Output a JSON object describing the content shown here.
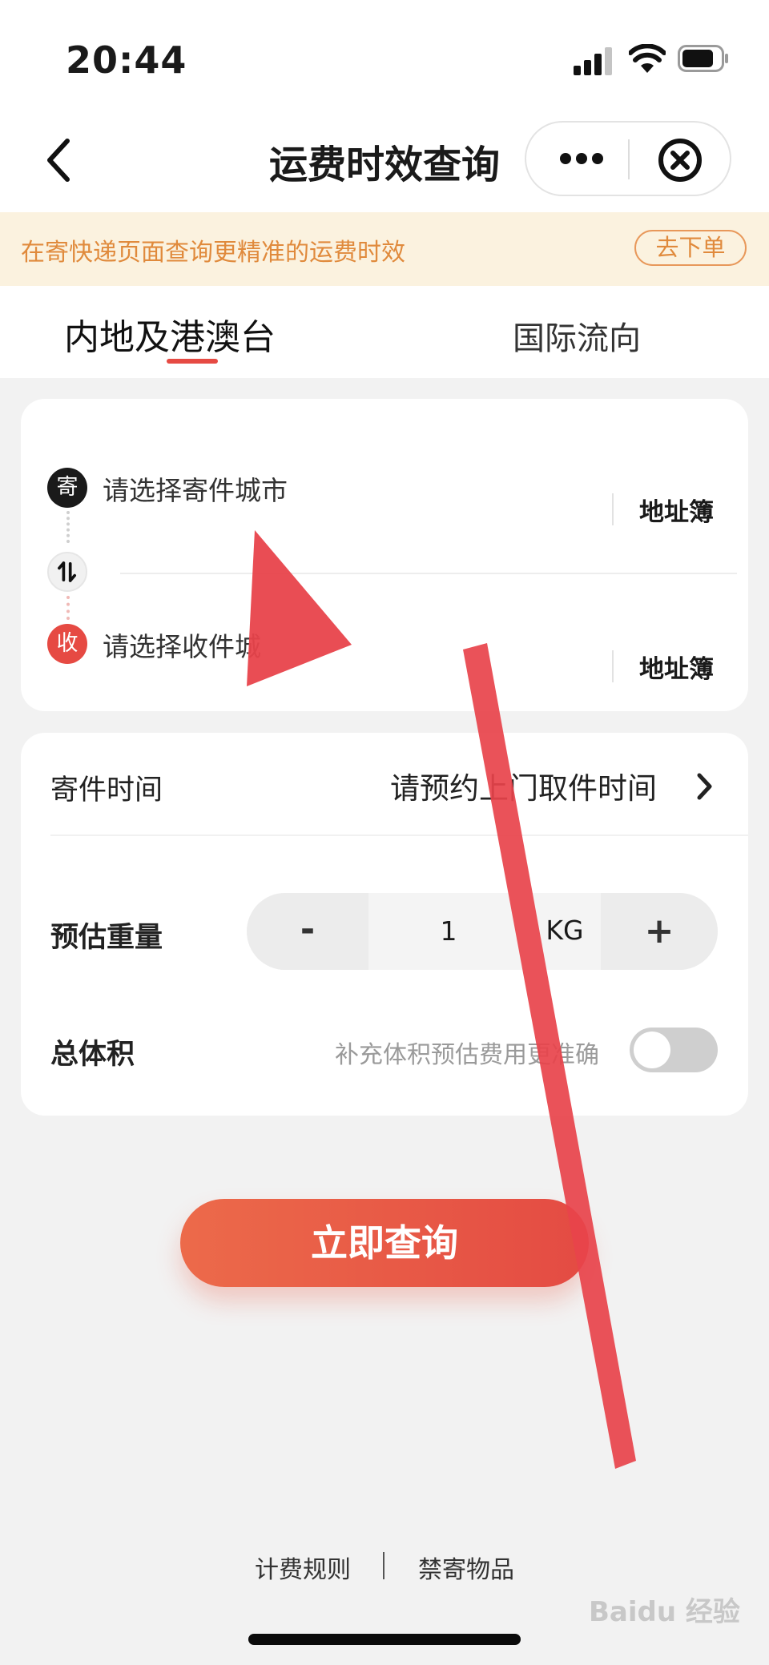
{
  "status_bar": {
    "time": "20:44"
  },
  "nav": {
    "title": "运费时效查询"
  },
  "notice": {
    "text": "在寄快递页面查询更精准的运费时效",
    "button": "去下单"
  },
  "tabs": [
    {
      "label": "内地及港澳台",
      "active": true
    },
    {
      "label": "国际流向",
      "active": false
    }
  ],
  "address": {
    "send_badge": "寄",
    "send_placeholder": "请选择寄件城市",
    "recv_badge": "收",
    "recv_placeholder": "请选择收件城",
    "address_book": "地址簿"
  },
  "details": {
    "ship_time_label": "寄件时间",
    "ship_time_value": "请预约上门取件时间",
    "weight_label": "预估重量",
    "minus": "-",
    "weight_value": "1",
    "weight_unit": "KG",
    "plus": "+",
    "volume_label": "总体积",
    "volume_hint": "补充体积预估费用更准确",
    "volume_toggle_on": false
  },
  "query_button": "立即查询",
  "footer": {
    "fee_rules": "计费规则",
    "banned_items": "禁寄物品"
  },
  "watermark": "Baidu 经验",
  "colors": {
    "accent": "#e64a43",
    "notice_text": "#e08a3c",
    "annotation_arrow": "#e8434b"
  }
}
